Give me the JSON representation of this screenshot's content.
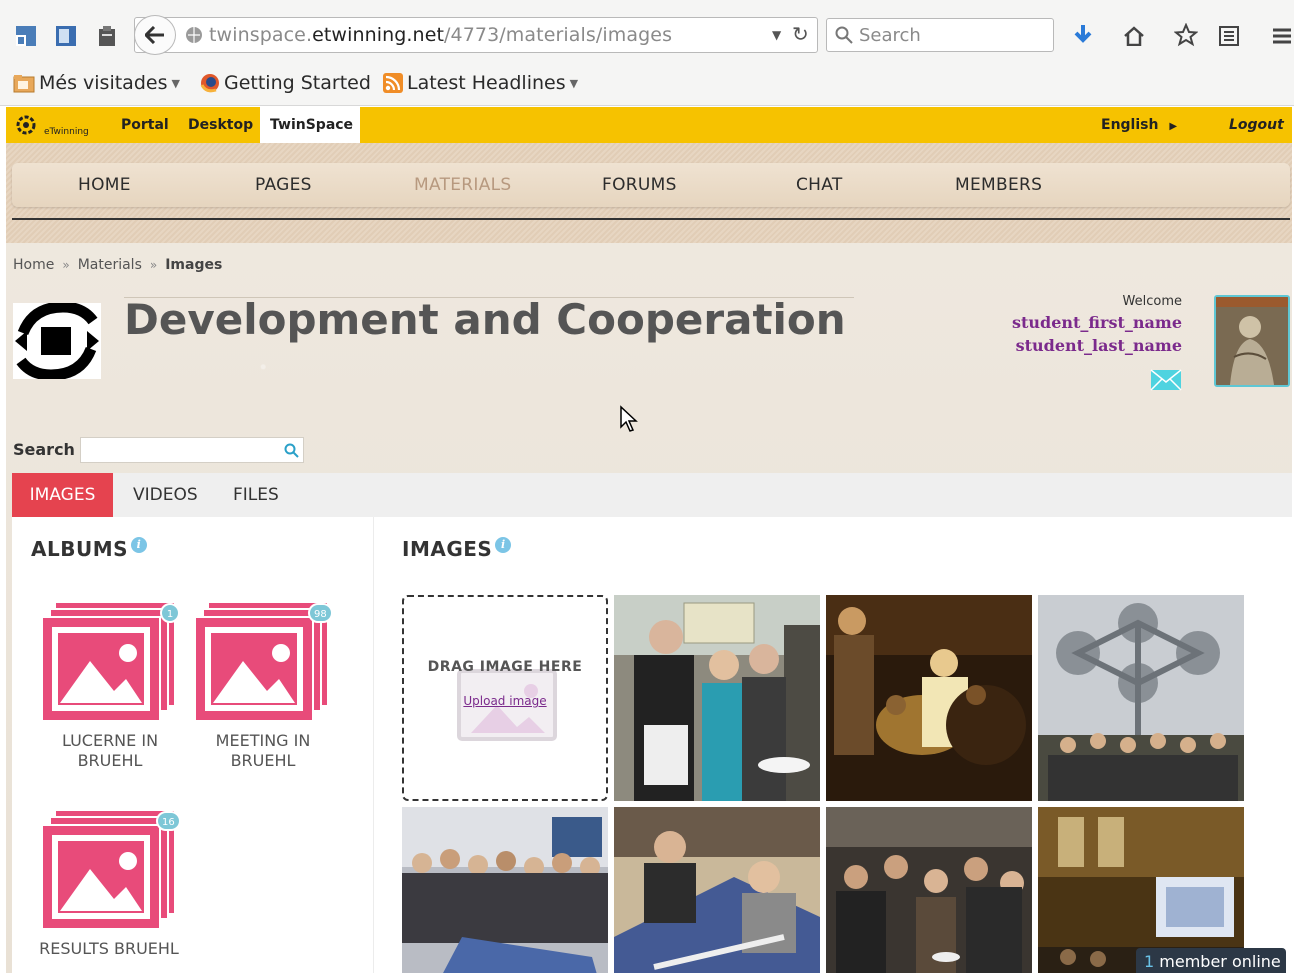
{
  "browser": {
    "url_prefix": "twinspace.",
    "url_domain": "etwinning.net",
    "url_path": "/4773/materials/images",
    "search_placeholder": "Search",
    "bookmarks": [
      {
        "label": "Més visitades",
        "icon": "folder-icon",
        "dropdown": true
      },
      {
        "label": "Getting Started",
        "icon": "firefox-icon",
        "dropdown": false
      },
      {
        "label": "Latest Headlines",
        "icon": "rss-icon",
        "dropdown": true
      }
    ]
  },
  "topbar": {
    "logo_text": "eTwinning",
    "links": [
      "Portal",
      "Desktop",
      "TwinSpace"
    ],
    "active_link": "TwinSpace",
    "language": "English",
    "logout": "Logout",
    "accent_color": "#f6c200"
  },
  "main_nav": {
    "items": [
      "HOME",
      "PAGES",
      "MATERIALS",
      "FORUMS",
      "CHAT",
      "MEMBERS"
    ],
    "active": "MATERIALS",
    "active_color": "#b7997f"
  },
  "breadcrumb": {
    "items": [
      "Home",
      "Materials",
      "Images"
    ],
    "separator": "»"
  },
  "site": {
    "title": "Development and Cooperation"
  },
  "user": {
    "welcome": "Welcome",
    "first_name": "student_first_name",
    "last_name": "student_last_name"
  },
  "search": {
    "label": "Search",
    "value": ""
  },
  "tabs": {
    "items": [
      "IMAGES",
      "VIDEOS",
      "FILES"
    ],
    "active": "IMAGES",
    "active_color": "#e5434f"
  },
  "albums": {
    "heading": "ALBUMS",
    "list": [
      {
        "label_line1": "LUCERNE IN",
        "label_line2": "BRUEHL",
        "count": "1"
      },
      {
        "label_line1": "MEETING IN",
        "label_line2": "BRUEHL",
        "count": "98"
      },
      {
        "label_line1": "RESULTS BRUEHL",
        "label_line2": "",
        "count": "16"
      }
    ],
    "icon_color": "#e84b7a"
  },
  "images": {
    "heading": "IMAGES",
    "drop_title": "DRAG IMAGE HERE",
    "upload_link": "Upload image"
  },
  "online": {
    "count": "1",
    "label": "member online"
  }
}
